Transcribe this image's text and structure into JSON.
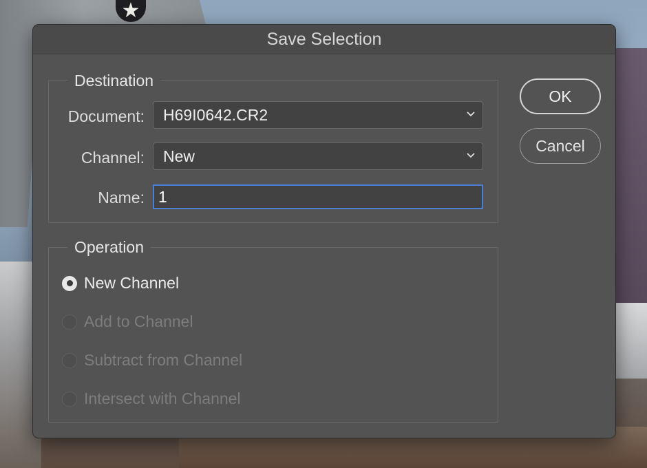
{
  "dialog": {
    "title": "Save Selection",
    "ok_label": "OK",
    "cancel_label": "Cancel"
  },
  "destination": {
    "legend": "Destination",
    "document_label": "Document:",
    "document_value": "H69I0642.CR2",
    "channel_label": "Channel:",
    "channel_value": "New",
    "name_label": "Name:",
    "name_value": "1"
  },
  "operation": {
    "legend": "Operation",
    "options": [
      {
        "label": "New Channel",
        "selected": true,
        "enabled": true
      },
      {
        "label": "Add to Channel",
        "selected": false,
        "enabled": false
      },
      {
        "label": "Subtract from Channel",
        "selected": false,
        "enabled": false
      },
      {
        "label": "Intersect with Channel",
        "selected": false,
        "enabled": false
      }
    ]
  },
  "colors": {
    "dialog_bg": "#535353",
    "focus_border": "#4a7fd4"
  }
}
